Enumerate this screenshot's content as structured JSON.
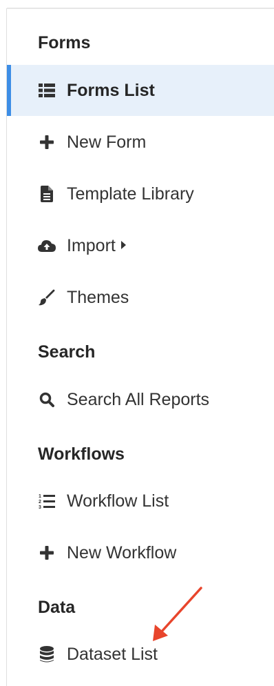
{
  "sections": {
    "forms": "Forms",
    "search": "Search",
    "workflows": "Workflows",
    "data": "Data"
  },
  "items": {
    "forms_list": "Forms List",
    "new_form": "New Form",
    "template_library": "Template Library",
    "import": "Import",
    "themes": "Themes",
    "search_all_reports": "Search All Reports",
    "workflow_list": "Workflow List",
    "new_workflow": "New Workflow",
    "dataset_list": "Dataset List"
  },
  "colors": {
    "active_bg": "#e7f0fa",
    "active_accent": "#3d8ee6",
    "annotation_arrow": "#e8452c"
  },
  "icons": {
    "forms_list": "list-icon",
    "new_form": "plus-icon",
    "template_library": "file-icon",
    "import": "cloud-upload-icon",
    "themes": "paintbrush-icon",
    "search_all_reports": "search-icon",
    "workflow_list": "numbered-list-icon",
    "new_workflow": "plus-icon",
    "dataset_list": "database-icon"
  }
}
